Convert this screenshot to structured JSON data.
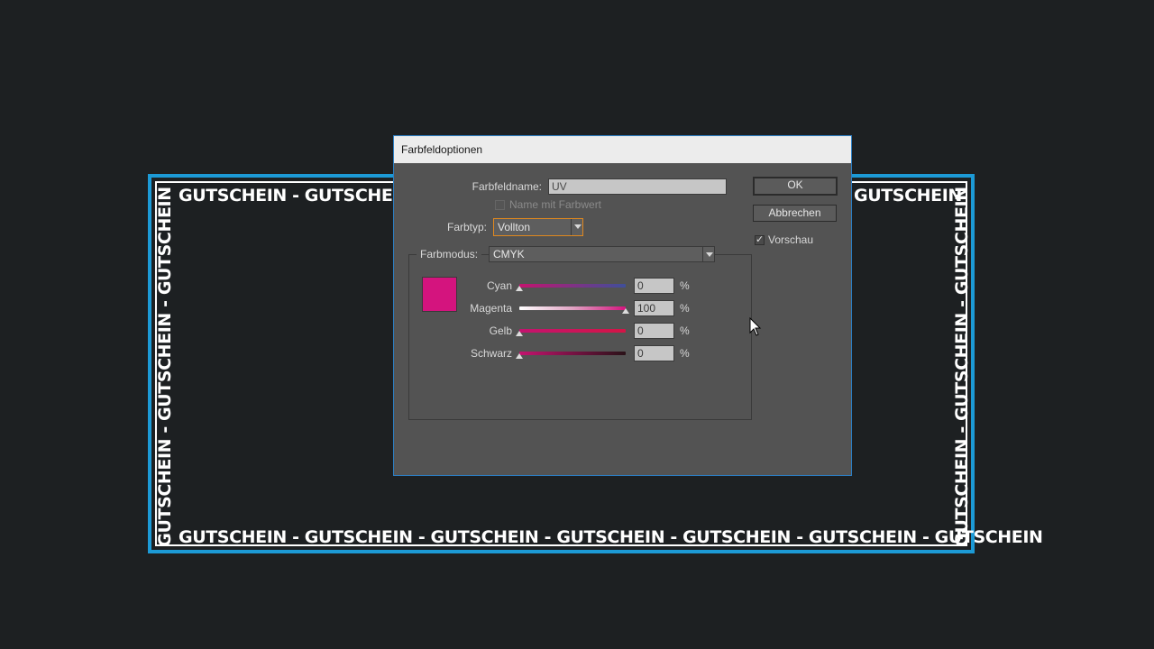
{
  "voucher": {
    "top_left_text": "GUTSCHEIN - GUTSCHEIN -",
    "top_right_text": "GUTSCHEIN",
    "bottom_text": "GUTSCHEIN - GUTSCHEIN - GUTSCHEIN - GUTSCHEIN - GUTSCHEIN - GUTSCHEIN - GUTSCHEIN",
    "left_text": "GUTSCHEIN - GUTSCHEIN - GUTSCHEIN",
    "right_text": "GUTSCHEIN - GUTSCHEIN - GUTSCHEIN",
    "border_color": "#1c9ad6"
  },
  "dialog": {
    "title": "Farbfeldoptionen",
    "swatch_name_label": "Farbfeldname:",
    "swatch_name_value": "UV",
    "name_with_value_label": "Name mit Farbwert",
    "color_type_label": "Farbtyp:",
    "color_type_value": "Vollton",
    "color_mode_label": "Farbmodus:",
    "color_mode_value": "CMYK",
    "ok_label": "OK",
    "cancel_label": "Abbrechen",
    "preview_label": "Vorschau",
    "preview_checked": true,
    "swatch_color": "#d4147e",
    "percent_sign": "%",
    "sliders": [
      {
        "label": "Cyan",
        "value": "0",
        "fraction": 0.0
      },
      {
        "label": "Magenta",
        "value": "100",
        "fraction": 1.0
      },
      {
        "label": "Gelb",
        "value": "0",
        "fraction": 0.0
      },
      {
        "label": "Schwarz",
        "value": "0",
        "fraction": 0.0
      }
    ]
  }
}
